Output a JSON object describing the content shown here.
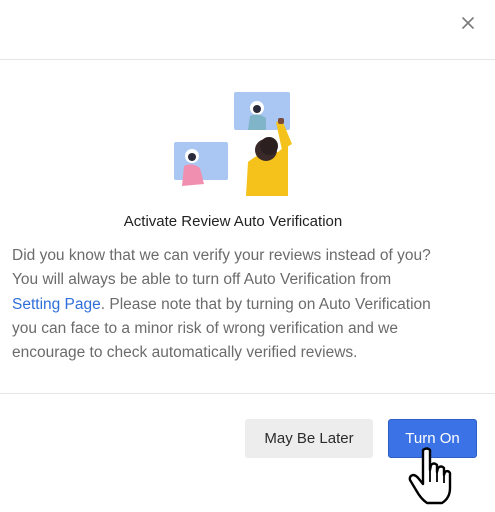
{
  "dialog": {
    "title": "Activate Review Auto Verification",
    "body_line1": "Did you know that we can verify your reviews instead of you?",
    "body_line2": "You will always be able to turn off Auto Verification from",
    "body_link": "Setting Page",
    "body_line3_rest": ". Please note that by turning on Auto Verification",
    "body_line4": "you can face to a minor risk of wrong verification and we",
    "body_line5": "encourage to check automatically verified reviews."
  },
  "buttons": {
    "later_label": "May Be Later",
    "turn_on_label": "Turn On"
  },
  "icons": {
    "close": "close-icon",
    "cursor": "hand-pointer-icon",
    "illustration": "verification-illustration"
  },
  "colors": {
    "primary": "#3b73e6",
    "link": "#2f6fd9",
    "secondary_button": "#ededed",
    "illustration_card": "#a9c7f2",
    "illustration_pink": "#f08fb0",
    "illustration_yellow": "#f5c21b"
  }
}
